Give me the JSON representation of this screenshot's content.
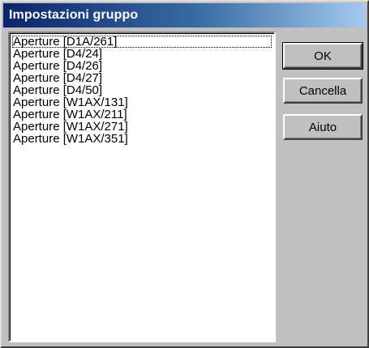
{
  "window": {
    "title": "Impostazioni gruppo"
  },
  "list": {
    "items": [
      "Aperture [D1A/261]",
      "Aperture [D4/24]",
      "Aperture [D4/26]",
      "Aperture [D4/27]",
      "Aperture [D4/50]",
      "Aperture [W1AX/131]",
      "Aperture [W1AX/211]",
      "Aperture [W1AX/271]",
      "Aperture [W1AX/351]"
    ]
  },
  "buttons": {
    "ok_label": "OK",
    "cancel_label": "Cancella",
    "help_label": "Aiuto"
  }
}
